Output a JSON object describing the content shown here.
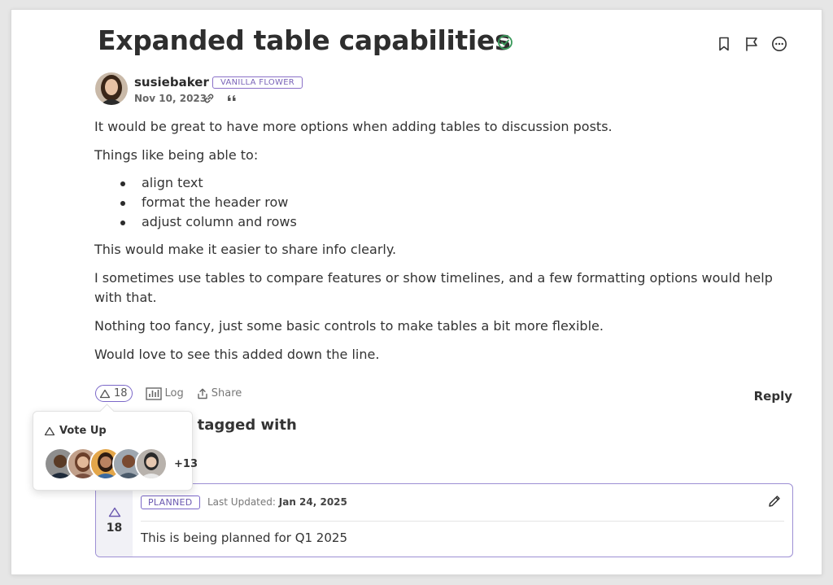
{
  "post": {
    "title": "Expanded table capabilities",
    "author": "susiebaker",
    "rank": "VANILLA FLOWER",
    "date": "Nov 10, 2023",
    "paragraphs_before_list": [
      "It would be great to have more options when adding tables to discussion posts.",
      "Things like being able to:"
    ],
    "list_items": [
      "align text",
      "format the header row",
      "adjust column and rows"
    ],
    "paragraphs_after_list": [
      "This would make it easier to share info clearly.",
      "I sometimes use tables to compare features or show timelines, and a few formatting options would help with that.",
      "Nothing too fancy, just some basic controls to make tables a bit more flexible.",
      "Would love to see this added down the line."
    ]
  },
  "reactions": {
    "vote_count": "18",
    "log_label": "Log",
    "share_label": "Share",
    "reply_label": "Reply"
  },
  "tagged": {
    "heading": "osts tagged with"
  },
  "status": {
    "badge": "PLANNED",
    "last_updated_label": "Last Updated:",
    "last_updated_date": "Jan 24, 2025",
    "vote_count": "18",
    "text": "This is being planned for Q1 2025"
  },
  "vote_popover": {
    "title": "Vote Up",
    "more_count": "+13"
  },
  "colors": {
    "accent": "#7b68c8",
    "check": "#3a9a5b"
  },
  "icons": [
    "check-circle-icon",
    "bookmark-icon",
    "flag-icon",
    "more-options-icon",
    "link-icon",
    "quote-icon",
    "vote-up-icon",
    "log-chart-icon",
    "share-icon",
    "edit-pencil-icon"
  ]
}
